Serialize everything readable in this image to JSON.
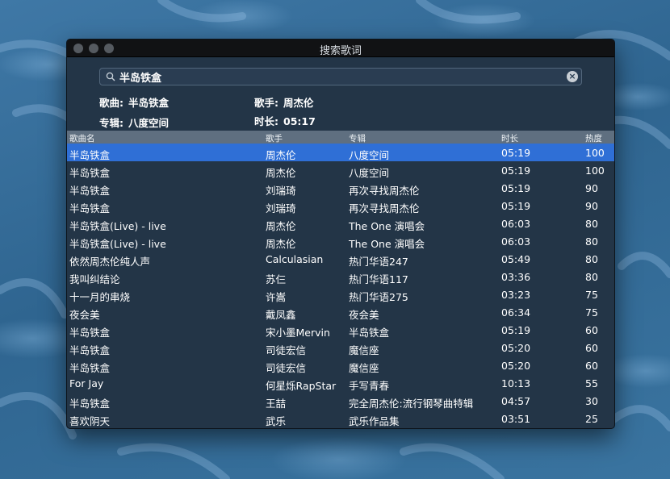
{
  "window": {
    "title": "搜索歌词"
  },
  "search": {
    "query": "半岛铁盒"
  },
  "info": {
    "song_label": "歌曲:",
    "song": "半岛铁盒",
    "artist_label": "歌手:",
    "artist": "周杰伦",
    "album_label": "专辑:",
    "album": "八度空间",
    "duration_label": "时长:",
    "duration": "05:17"
  },
  "table": {
    "headers": [
      "歌曲名",
      "歌手",
      "专辑",
      "时长",
      "热度"
    ],
    "rows": [
      [
        "半岛铁盒",
        "周杰伦",
        "八度空间",
        "05:19",
        "100"
      ],
      [
        "半岛铁盒",
        "周杰伦",
        "八度空间",
        "05:19",
        "100"
      ],
      [
        "半岛铁盒",
        "刘瑞琦",
        "再次寻找周杰伦",
        "05:19",
        "90"
      ],
      [
        "半岛铁盒",
        "刘瑞琦",
        "再次寻找周杰伦",
        "05:19",
        "90"
      ],
      [
        "半岛铁盒(Live) - live",
        "周杰伦",
        "The One 演唱会",
        "06:03",
        "80"
      ],
      [
        "半岛铁盒(Live) - live",
        "周杰伦",
        "The One 演唱会",
        "06:03",
        "80"
      ],
      [
        "依然周杰伦纯人声",
        "Calculasian",
        "热门华语247",
        "05:49",
        "80"
      ],
      [
        "我叫纠结论",
        "苏仨",
        "热门华语117",
        "03:36",
        "80"
      ],
      [
        "十一月的串烧",
        "许嵩",
        "热门华语275",
        "03:23",
        "75"
      ],
      [
        "夜会美",
        "戴凤鑫",
        "夜会美",
        "06:34",
        "75"
      ],
      [
        "半岛铁盒",
        "宋小墨Mervin",
        "半岛铁盒",
        "05:19",
        "60"
      ],
      [
        "半岛铁盒",
        "司徒宏信",
        "魔信座",
        "05:20",
        "60"
      ],
      [
        "半岛铁盒",
        "司徒宏信",
        "魔信座",
        "05:20",
        "60"
      ],
      [
        "For Jay",
        "何星烁RapStar",
        "手写青春",
        "10:13",
        "55"
      ],
      [
        "半岛铁盒",
        "王喆",
        "完全周杰伦:流行钢琴曲特辑",
        "04:57",
        "30"
      ],
      [
        "喜欢阴天",
        "武乐",
        "武乐作品集",
        "03:51",
        "25"
      ]
    ],
    "selected_row": 0
  },
  "colors": {
    "selection": "#2f6fd6",
    "window_bg": "#233547",
    "header_bg": "#5f6f80"
  },
  "icons": {
    "search": "magnifier-icon",
    "clear": "clear-icon"
  }
}
